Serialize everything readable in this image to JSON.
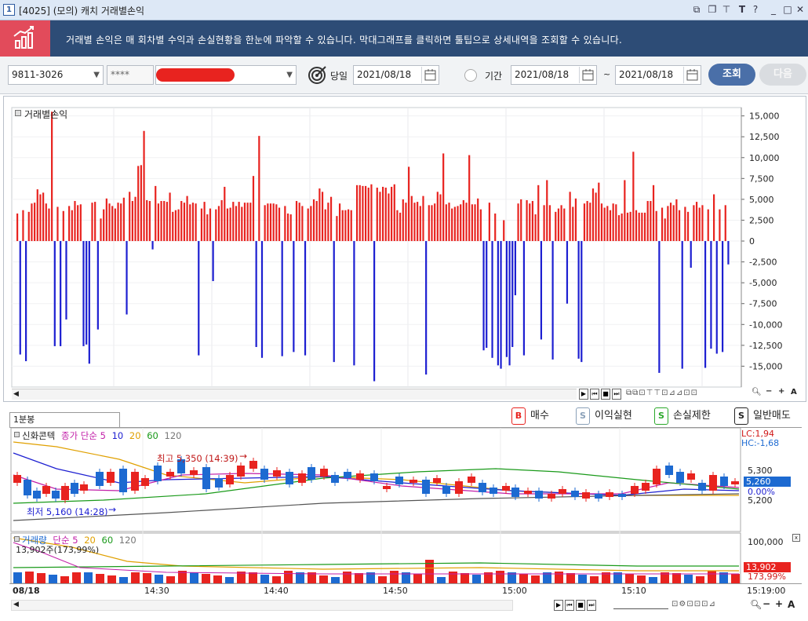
{
  "window": {
    "number": "1",
    "title": "[4025] (모의) 캐치 거래별손익",
    "buttons": [
      "⧉",
      "⧉",
      "↑",
      "T",
      "?",
      "_",
      "□",
      "✕"
    ]
  },
  "banner": {
    "text": "거래별 손익은 매 회차별 수익과 손실현황을 한눈에 파악할 수 있습니다. 막대그래프를 클릭하면 툴팁으로 상세내역을 조회할 수 있습니다."
  },
  "toolbar": {
    "account": "9811-3026",
    "password": "****",
    "today_label": "당일",
    "today_date": "2021/08/18",
    "period_label": "기간",
    "period_from": "2021/08/18",
    "tilde": "~",
    "period_to": "2021/08/18",
    "search_btn": "조회",
    "next_btn": "다음"
  },
  "main_chart": {
    "title": "거래별손익",
    "axis_ticks": [
      "15,000",
      "12,500",
      "10,000",
      "7,500",
      "5,000",
      "2,500",
      "0",
      "-2,500",
      "-5,000",
      "-7,500",
      "-10,000",
      "-12,500",
      "-15,000"
    ]
  },
  "chart_data": [
    {
      "type": "bar",
      "title": "거래별손익",
      "ylim": [
        -17500,
        16000
      ],
      "positive_color": "#e8231f",
      "negative_color": "#1d1fd1",
      "values": [
        3300,
        -13600,
        3700,
        -14400,
        3500,
        4500,
        4600,
        6200,
        5600,
        5800,
        4500,
        3900,
        15500,
        -12600,
        4100,
        -12600,
        3600,
        -9400,
        4200,
        3700,
        4800,
        4300,
        4400,
        -12600,
        -12400,
        -14700,
        4600,
        4700,
        -10600,
        2700,
        3800,
        5100,
        4500,
        4200,
        3900,
        4600,
        4500,
        5200,
        -8800,
        5900,
        4800,
        5300,
        9000,
        9100,
        13200,
        4900,
        4800,
        -1000,
        6600,
        4500,
        4800,
        4800,
        4700,
        5800,
        3500,
        3700,
        3800,
        4800,
        4600,
        5400,
        4400,
        4600,
        4500,
        -13700,
        3900,
        4700,
        3200,
        3900,
        -4800,
        3800,
        4200,
        4900,
        6500,
        3900,
        4000,
        4700,
        4200,
        4700,
        4100,
        4600,
        4600,
        4600,
        7800,
        -12700,
        12600,
        -14000,
        4300,
        4500,
        4500,
        4500,
        4400,
        4000,
        -13800,
        4200,
        3300,
        3200,
        -13300,
        4800,
        4600,
        4200,
        -13700,
        3900,
        4200,
        5000,
        4800,
        6300,
        5900,
        3800,
        4600,
        5300,
        -14500,
        3000,
        4500,
        3700,
        3700,
        3800,
        3700,
        -14900,
        6700,
        6700,
        6600,
        6600,
        6400,
        6800,
        -16800,
        6400,
        5900,
        6500,
        6400,
        5700,
        6500,
        6800,
        3700,
        3400,
        5000,
        4600,
        8900,
        5400,
        4600,
        4700,
        4200,
        5400,
        -16000,
        4300,
        4300,
        4500,
        5900,
        5600,
        10500,
        4400,
        4600,
        3900,
        4100,
        4200,
        4400,
        4900,
        4600,
        10300,
        4400,
        4400,
        5100,
        3800,
        -13100,
        -12800,
        4600,
        -14000,
        3300,
        -14900,
        -15300,
        2500,
        -13900,
        -14900,
        -12700,
        -6500,
        4500,
        5000,
        -13700,
        4900,
        4500,
        4800,
        3200,
        6700,
        -11800,
        4300,
        7300,
        4300,
        -14200,
        3500,
        3900,
        4300,
        3900,
        -7500,
        5900,
        4100,
        5100,
        -14100,
        -14500,
        4500,
        4800,
        4600,
        6300,
        5800,
        7000,
        4500,
        4000,
        4200,
        3700,
        4500,
        4400,
        3100,
        3300,
        7300,
        3400,
        3500,
        10700,
        3700,
        3400,
        3400,
        3400,
        4800,
        4800,
        6700,
        3600,
        -15800,
        4000,
        2700,
        4200,
        4600,
        4300,
        5000,
        3700,
        -15300,
        4100,
        3500,
        -3200,
        4300,
        4700,
        4000,
        4300,
        -15200,
        3800,
        -12900,
        5600,
        -13500,
        3800,
        -13300,
        4300,
        -2800
      ]
    },
    {
      "type": "line",
      "title": "신화콘텍",
      "x_ticks": [
        "08/18",
        "14:30",
        "14:40",
        "14:50",
        "15:00",
        "15:10",
        "15:19:00"
      ],
      "y_ticks": [
        "5,300",
        "5,200"
      ],
      "ylim": [
        5120,
        5400
      ],
      "series": [
        {
          "name": "종가 단순 5"
        },
        {
          "name": "10"
        },
        {
          "name": "20"
        },
        {
          "name": "60"
        },
        {
          "name": "120"
        }
      ],
      "annotations": [
        "최고 5,350 (14:39)",
        "최저 5,160 (14:28)"
      ],
      "lc": "LC:1,94",
      "hc": "HC:-1,68",
      "current_price": "5,260",
      "change": "0.00%"
    },
    {
      "type": "bar",
      "title": "거래량",
      "series": [
        {
          "name": "단순 5"
        },
        {
          "name": "20"
        },
        {
          "name": "60"
        },
        {
          "name": "120"
        }
      ],
      "volume_text": "13,902주(173,99%)",
      "y_ticks": [
        "100,000"
      ],
      "current_volume": "13,902",
      "volume_ratio": "173,99%"
    }
  ],
  "lower_panel": {
    "tab_label": "1분봉",
    "legend": [
      {
        "badge": "B",
        "label": "매수",
        "color": "#e8231f"
      },
      {
        "badge": "S",
        "label": "이익실현",
        "color": "#8aa0b8"
      },
      {
        "badge": "S",
        "label": "손실제한",
        "color": "#2aa82a"
      },
      {
        "badge": "S",
        "label": "일반매도",
        "color": "#222222"
      }
    ],
    "price_title": "신화콘텍",
    "price_ma_label": "종가 단순",
    "price_ma": [
      "5",
      "10",
      "20",
      "60",
      "120"
    ],
    "volume_title": "거래량",
    "volume_ma_label": "단순 5",
    "volume_ma": [
      "20",
      "60",
      "120"
    ]
  }
}
